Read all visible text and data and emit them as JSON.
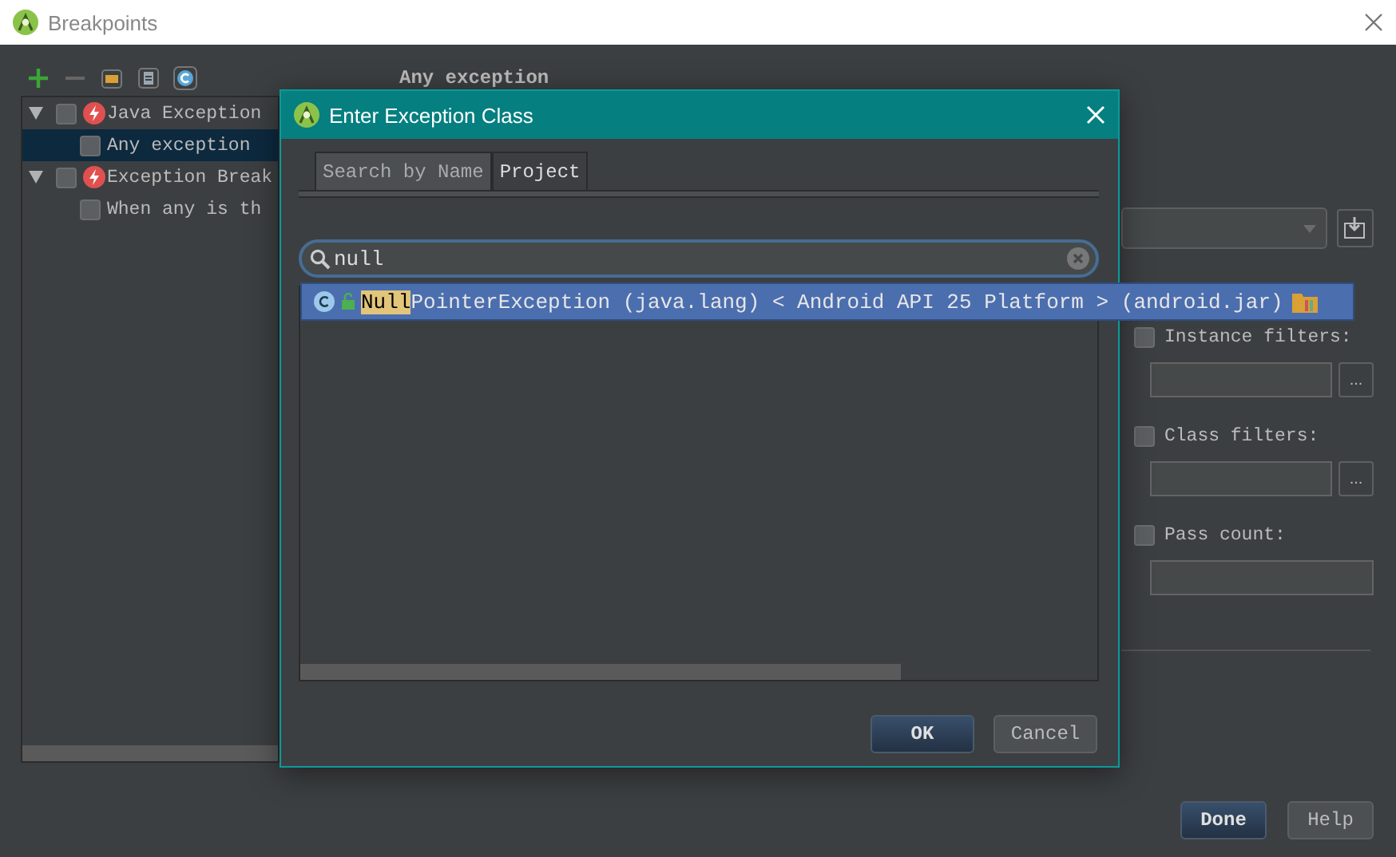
{
  "window": {
    "title": "Breakpoints"
  },
  "tree": [
    {
      "label": "Java Exception",
      "checked": false,
      "expanded": true,
      "selected": false,
      "children": [
        {
          "label": "Any exception",
          "checked": false,
          "selected": true
        }
      ]
    },
    {
      "label": "Exception Break",
      "checked": false,
      "expanded": true,
      "selected": false,
      "children": [
        {
          "label": "When any is th",
          "checked": false,
          "selected": false
        }
      ]
    }
  ],
  "details": {
    "title": "Any exception",
    "filters": [
      {
        "label": "Instance filters:",
        "checked": false,
        "button": "..."
      },
      {
        "label": "Class filters:",
        "checked": false,
        "button": "..."
      },
      {
        "label": "Pass count:",
        "checked": false
      }
    ]
  },
  "buttons": [
    {
      "label": "Done",
      "default": true
    },
    {
      "label": "Help",
      "default": false
    }
  ],
  "dialog": {
    "title": "Enter Exception Class",
    "tabs": [
      {
        "label": "Search by Name",
        "selected": true
      },
      {
        "label": "Project",
        "selected": false
      }
    ],
    "search": {
      "value": "null"
    },
    "results": [
      {
        "match": "Null",
        "rest": "PointerException (java.lang) < Android API 25 Platform > (android.jar)",
        "selected": true
      }
    ],
    "buttons": [
      {
        "label": "OK",
        "default": true
      },
      {
        "label": "Cancel",
        "default": false
      }
    ]
  }
}
